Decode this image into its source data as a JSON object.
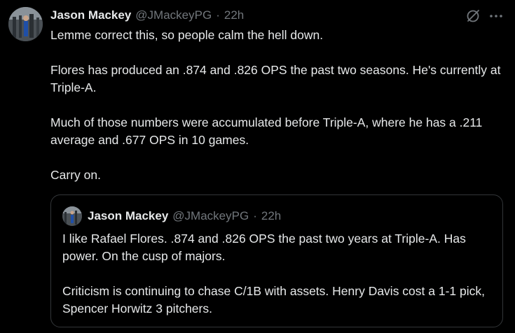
{
  "tweet": {
    "author_name": "Jason Mackey",
    "author_handle": "@JMackeyPG",
    "separator": "·",
    "time": "22h",
    "paragraphs": [
      "Lemme correct this, so people calm the hell down.",
      "Flores has produced an .874 and .826 OPS the past two seasons. He's currently at Triple-A.",
      "Much of those numbers were accumulated before Triple-A, where he has a .211 average and .677 OPS in 10 games.",
      "Carry on."
    ],
    "icons": {
      "grok": "grok-icon",
      "more": "more-options-icon"
    }
  },
  "quoted_tweet": {
    "author_name": "Jason Mackey",
    "author_handle": "@JMackeyPG",
    "separator": "·",
    "time": "22h",
    "paragraphs": [
      "I like Rafael Flores. .874 and .826 OPS the past two years at Triple-A. Has power. On the cusp of majors.",
      "Criticism is continuing to chase C/1B with assets. Henry Davis cost a 1-1 pick, Spencer Horwitz 3 pitchers."
    ]
  },
  "colors": {
    "background": "#000000",
    "text": "#e7e9ea",
    "secondary": "#71767b",
    "border": "#333639"
  }
}
